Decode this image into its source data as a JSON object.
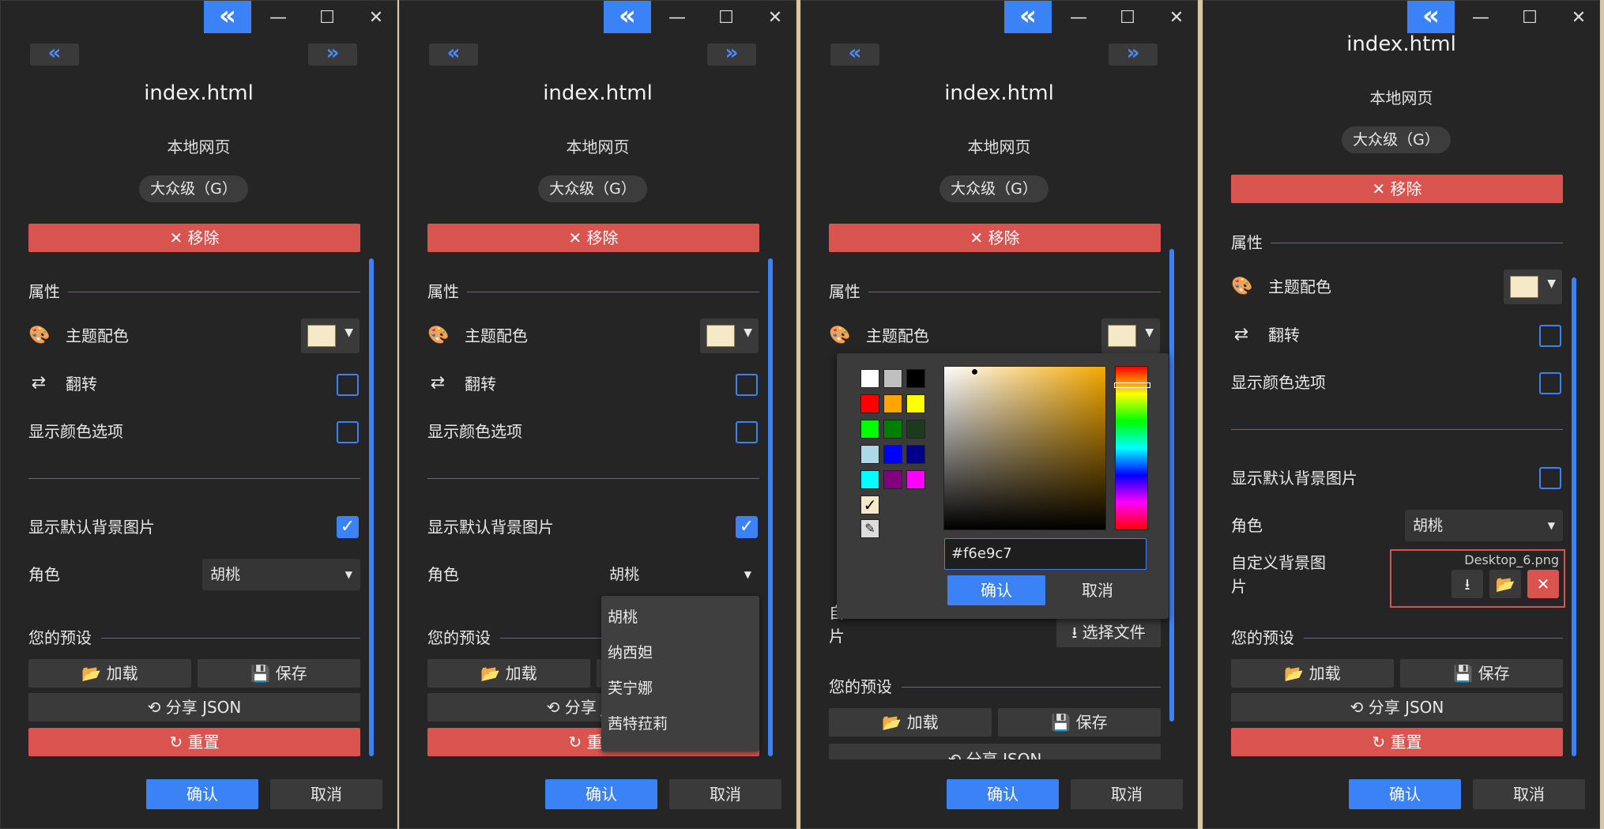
{
  "window": {
    "collapse_icon": "«",
    "minimize_icon": "—",
    "maximize_icon": "☐",
    "close_icon": "✕",
    "prev_icon": "«",
    "next_icon": "»"
  },
  "header": {
    "file_name": "index.html",
    "subtitle": "本地网页",
    "rating": "大众级（G）",
    "remove_label": "✕ 移除"
  },
  "properties": {
    "section_title": "属性",
    "theme_color_label": "主题配色",
    "theme_color_value": "#f6e9c7",
    "flip_label": "翻转",
    "show_color_options_label": "显示颜色选项",
    "show_default_bg_label": "显示默认背景图片",
    "role_label": "角色",
    "role_value": "胡桃",
    "custom_bg_label": "自定义背景图片",
    "custom_bg_label_line1": "自定义背景图",
    "custom_bg_label_line2": "片",
    "custom_bg_file": "Desktop_6.png",
    "custom_bg_initial": "自",
    "custom_bg_trailing": "片",
    "select_file_label": "选择文件"
  },
  "role_options": [
    "胡桃",
    "纳西妲",
    "芙宁娜",
    "茜特菈莉"
  ],
  "presets": {
    "section_title": "您的预设",
    "load_label": "加载",
    "save_label": "保存",
    "share_label": "分享 JSON",
    "reset_label": "重置"
  },
  "footer": {
    "confirm_label": "确认",
    "cancel_label": "取消"
  },
  "color_picker": {
    "hex_value": "#f6e9c7",
    "confirm_label": "确认",
    "cancel_label": "取消",
    "swatches": [
      "#ffffff",
      "#c0c0c0",
      "#000000",
      "#ff0000",
      "#ffa500",
      "#ffff00",
      "#00ff00",
      "#008000",
      "#1e3a1e",
      "#add8e6",
      "#0000ff",
      "#00008b",
      "#00ffff",
      "#800080",
      "#ff00ff"
    ]
  },
  "colors": {
    "accent": "#3b82f6",
    "danger": "#d9534f",
    "background": "#252525"
  }
}
